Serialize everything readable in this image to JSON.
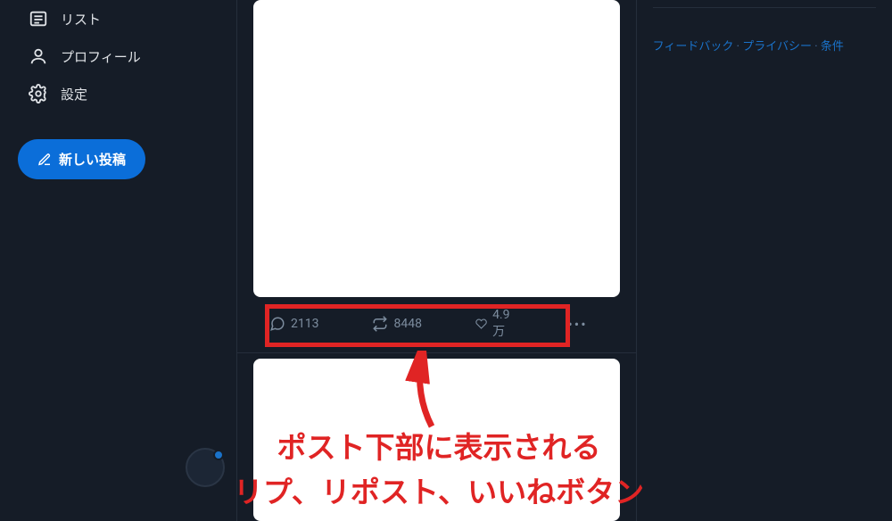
{
  "sidebar": {
    "items": [
      {
        "label": "リスト",
        "icon": "list-icon"
      },
      {
        "label": "プロフィール",
        "icon": "profile-icon"
      },
      {
        "label": "設定",
        "icon": "settings-icon"
      }
    ],
    "compose_label": "新しい投稿"
  },
  "post": {
    "actions": {
      "reply_count": "2113",
      "repost_count": "8448",
      "like_count": "4.9万"
    }
  },
  "annotation": {
    "line1": "ポスト下部に表示される",
    "line2": "リプ、リポスト、いいねボタン"
  },
  "footer": {
    "feedback": "フィードバック",
    "privacy": "プライバシー",
    "terms": "条件",
    "sep": " · "
  }
}
